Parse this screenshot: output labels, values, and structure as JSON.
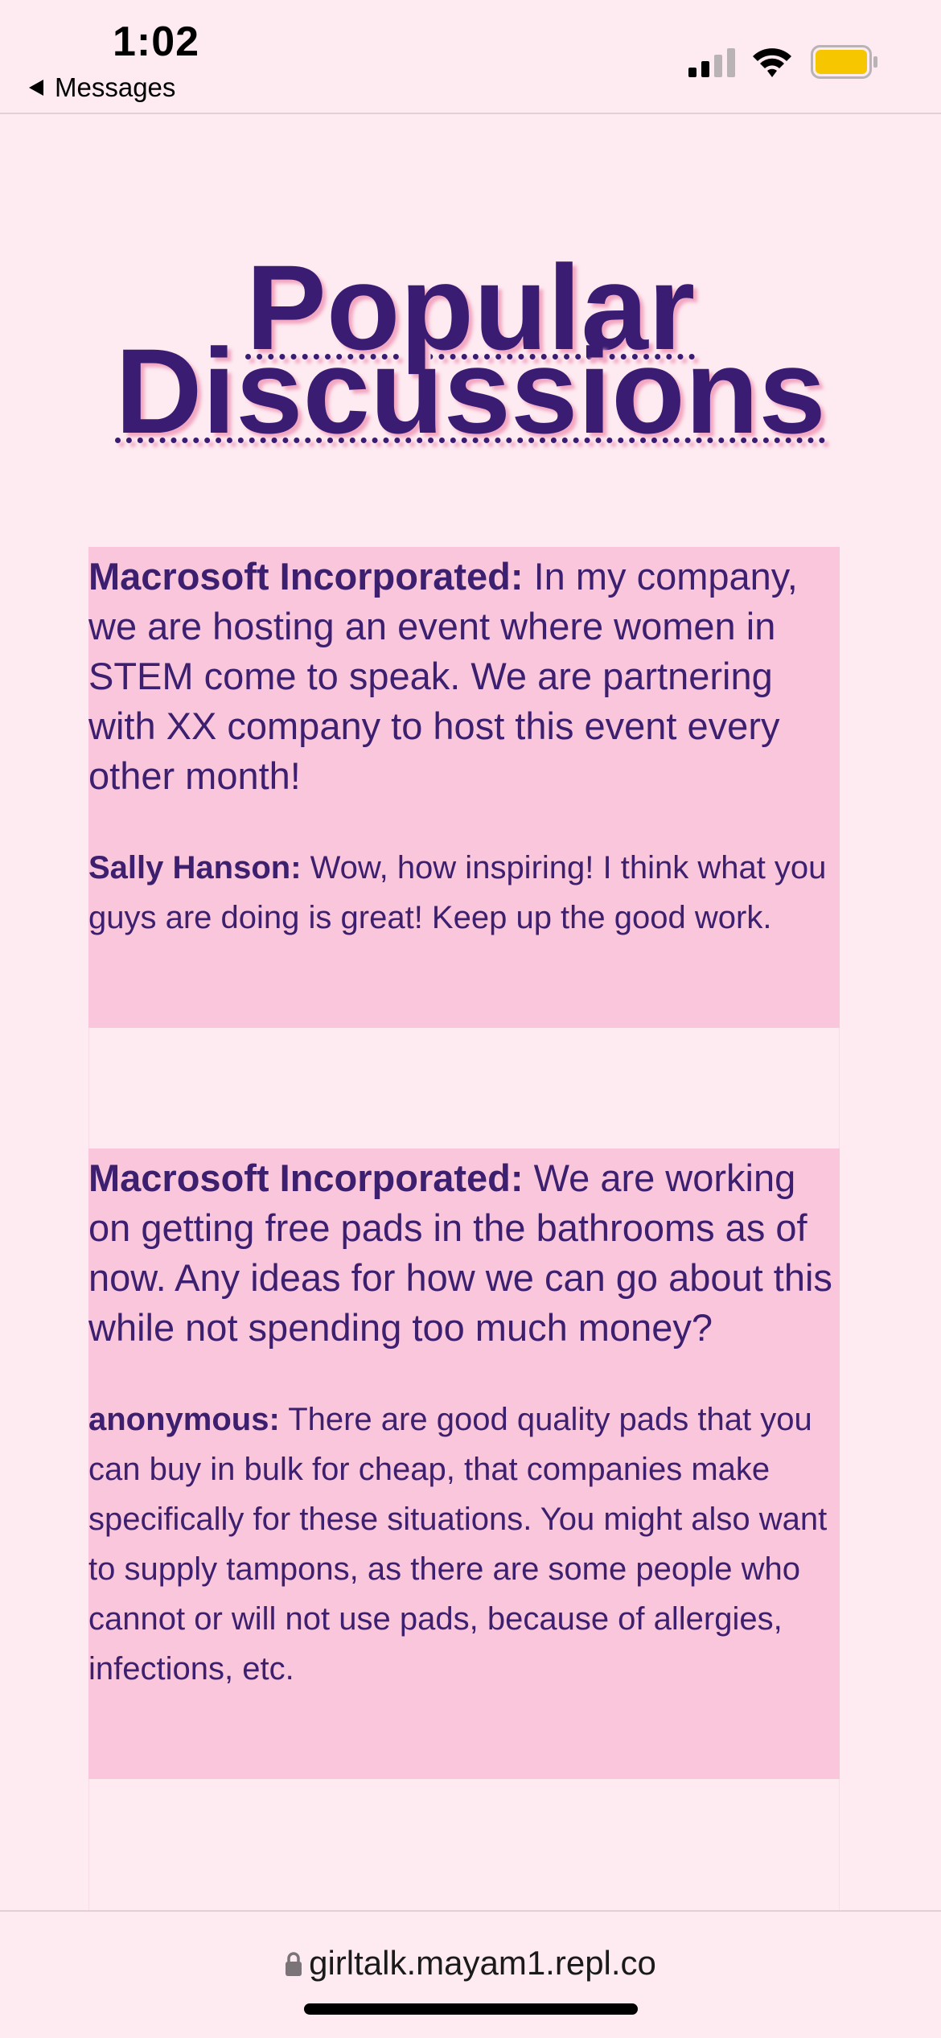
{
  "status_bar": {
    "time": "1:02",
    "back_label": "Messages",
    "battery_color": "#f6c700"
  },
  "page": {
    "title_line1": "Popular",
    "title_line2": "Discussions"
  },
  "discussions": [
    {
      "author": "Macrosoft Incorporated:",
      "text": " In my company, we are hosting an event where women in STEM come to speak. We are partnering with XX company to host this event every other month!",
      "reply": {
        "author": "Sally Hanson:",
        "text": " Wow, how inspiring! I think what you guys are doing is great! Keep up the good work."
      }
    },
    {
      "author": "Macrosoft Incorporated:",
      "text": " We are working on getting free pads in the bathrooms as of now. Any ideas for how we can go about this while not spending too much money?",
      "reply": {
        "author": "anonymous:",
        "text": " There are good quality pads that you can buy in bulk for cheap, that companies make specifically for these situations. You might also want to supply tampons, as there are some people who cannot or will not use pads, because of allergies, infections, etc."
      }
    }
  ],
  "browser": {
    "url": "girltalk.mayam1.repl.co"
  },
  "colors": {
    "background": "#fdebf1",
    "card": "#f9c6db",
    "text": "#3c1f6e",
    "title_shadow": "#f2a7c2"
  }
}
